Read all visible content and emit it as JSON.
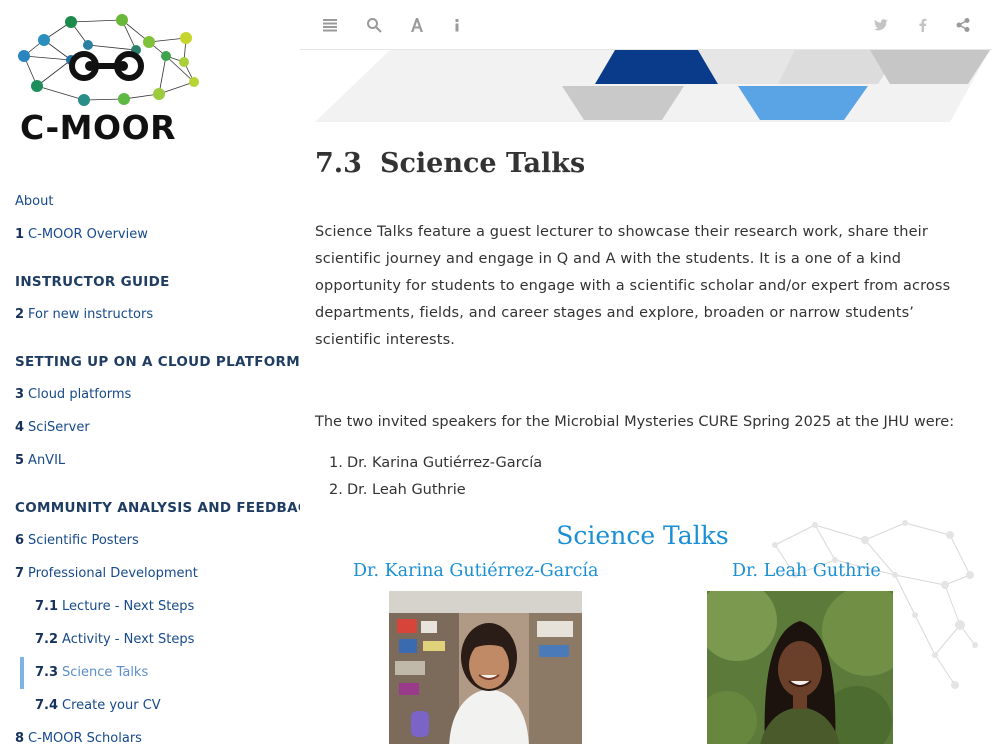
{
  "sidebar": {
    "logo_text": "C-MOOR",
    "items": [
      {
        "num": "",
        "label": "About"
      },
      {
        "num": "1",
        "label": "C-MOOR Overview"
      },
      {
        "part": "INSTRUCTOR GUIDE"
      },
      {
        "num": "2",
        "label": "For new instructors"
      },
      {
        "part": "SETTING UP ON A CLOUD PLATFORM"
      },
      {
        "num": "3",
        "label": "Cloud platforms"
      },
      {
        "num": "4",
        "label": "SciServer"
      },
      {
        "num": "5",
        "label": "AnVIL"
      },
      {
        "part": "COMMUNITY ANALYSIS AND FEEDBACK"
      },
      {
        "num": "6",
        "label": "Scientific Posters"
      },
      {
        "num": "7",
        "label": "Professional Development"
      },
      {
        "num": "7.1",
        "label": "Lecture - Next Steps"
      },
      {
        "num": "7.2",
        "label": "Activity - Next Steps"
      },
      {
        "num": "7.3",
        "label": "Science Talks"
      },
      {
        "num": "7.4",
        "label": "Create your CV"
      },
      {
        "num": "8",
        "label": "C-MOOR Scholars"
      }
    ]
  },
  "toolbar": {
    "left_icons": [
      "toc-list-icon",
      "search-icon",
      "font-settings-icon",
      "info-icon"
    ],
    "right_icons": [
      "twitter-icon",
      "facebook-icon",
      "share-icon"
    ]
  },
  "content": {
    "section_number": "7.3",
    "section_title": "Science Talks",
    "intro": "Science Talks feature a guest lecturer to showcase their research work, share their scientific journey and engage in Q and A with the students. It is a one of a kind opportunity for students to engage with a scientific scholar and/or expert from across departments, fields, and career stages and explore, broaden or narrow students’ scientific interests.",
    "speakers_intro": "The two invited speakers for the Microbial Mysteries CURE Spring 2025 at the JHU were:",
    "speakers": [
      {
        "n": "1.",
        "name": "Dr. Karina Gutiérrez-García"
      },
      {
        "n": "2.",
        "name": "Dr. Leah Guthrie"
      }
    ]
  },
  "figure": {
    "title": "Science Talks",
    "left_name": "Dr. Karina Gutiérrez-García",
    "right_name": "Dr. Leah Guthrie"
  },
  "colors": {
    "nav_link": "#174a8b",
    "accent_blue": "#1a8fd4",
    "active_bar": "#7fb2e5"
  }
}
